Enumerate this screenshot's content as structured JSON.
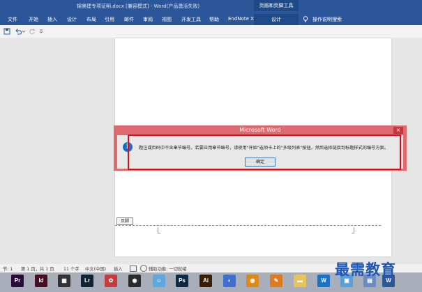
{
  "window": {
    "title": "锦美建专项证明.docx [兼容模式] - Word(产品激活失败)",
    "context_group": "页眉和页脚工具"
  },
  "ribbon": {
    "tabs": [
      "文件",
      "开始",
      "插入",
      "设计",
      "布局",
      "引用",
      "邮件",
      "审阅",
      "视图",
      "开发工具",
      "帮助",
      "EndNote X8"
    ],
    "context_tab": "设计",
    "tell_me": "操作说明搜索"
  },
  "footer": {
    "tag": "页脚"
  },
  "dialog": {
    "title": "Microsoft Word",
    "close": "×",
    "icon": "i",
    "message": "题注或页码中不含章节编号。若要应用章节编号，请使用\"开始\"选项卡上的\"多级列表\"按钮，然后选择链接到标题样式的编号方案。",
    "ok_label": "确定"
  },
  "status": {
    "section": "节: 1",
    "page": "第 1 页，共 1 页",
    "words": "11 个字",
    "language": "中文(中国)",
    "mode": "插入",
    "accessibility": "辅助功能: 一切就绪"
  },
  "taskbar": {
    "apps": [
      {
        "name": "premiere-icon",
        "label": "Pr",
        "color": "#2a0a3a"
      },
      {
        "name": "indesign-icon",
        "label": "Id",
        "color": "#4a0b24"
      },
      {
        "name": "film-app-icon",
        "label": "▦",
        "color": "#333333"
      },
      {
        "name": "lightroom-icon",
        "label": "Lr",
        "color": "#0e2436"
      },
      {
        "name": "photo-app-icon",
        "label": "✿",
        "color": "#c43c3c"
      },
      {
        "name": "qq-icon",
        "label": "◉",
        "color": "#2a2a2a"
      },
      {
        "name": "finder-icon",
        "label": "☺",
        "color": "#5ca8e0"
      },
      {
        "name": "photoshop-icon",
        "label": "Ps",
        "color": "#0b2c44"
      },
      {
        "name": "illustrator-icon",
        "label": "Ai",
        "color": "#3a1d02"
      },
      {
        "name": "browser-icon",
        "label": "◐",
        "color": "#3f6fd0"
      },
      {
        "name": "chrome-icon",
        "label": "◍",
        "color": "#dc8a1d"
      },
      {
        "name": "paint-icon",
        "label": "✎",
        "color": "#e07a20"
      },
      {
        "name": "folder-icon",
        "label": "▬",
        "color": "#e8c25a"
      },
      {
        "name": "wps-icon",
        "label": "W",
        "color": "#1873c9"
      },
      {
        "name": "image-viewer-icon",
        "label": "▣",
        "color": "#5aa0d8"
      },
      {
        "name": "explorer-icon",
        "label": "▤",
        "color": "#6a8cc0"
      },
      {
        "name": "word-icon",
        "label": "W",
        "color": "#2b579a"
      }
    ]
  },
  "watermark": "最需教育"
}
